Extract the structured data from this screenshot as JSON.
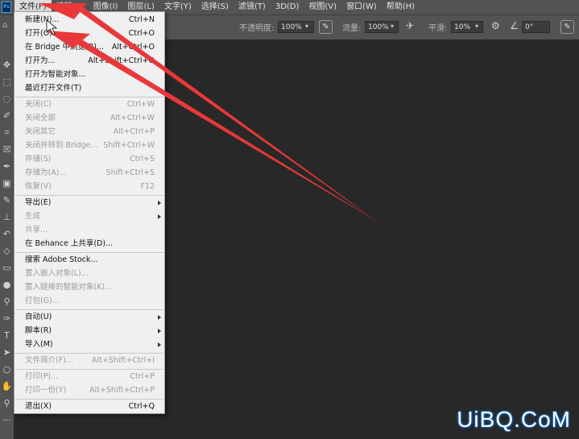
{
  "menubar": {
    "logo": "Ps",
    "items": [
      {
        "label": "文件(F)"
      },
      {
        "label": "编辑(E)"
      },
      {
        "label": "图像(I)"
      },
      {
        "label": "图层(L)"
      },
      {
        "label": "文字(Y)"
      },
      {
        "label": "选择(S)"
      },
      {
        "label": "滤镜(T)"
      },
      {
        "label": "3D(D)"
      },
      {
        "label": "视图(V)"
      },
      {
        "label": "窗口(W)"
      },
      {
        "label": "帮助(H)"
      }
    ]
  },
  "options": {
    "opacity_label": "不透明度:",
    "opacity_value": "100%",
    "flow_label": "流量:",
    "flow_value": "100%",
    "smoothing_label": "平滑:",
    "smoothing_value": "10%",
    "angle_value": "0°"
  },
  "file_menu": {
    "items": [
      {
        "label": "新建(N)...",
        "shortcut": "Ctrl+N"
      },
      {
        "label": "打开(O)...",
        "shortcut": "Ctrl+O"
      },
      {
        "label": "在 Bridge 中浏览(B)...",
        "shortcut": "Alt+Ctrl+O"
      },
      {
        "label": "打开为...",
        "shortcut": "Alt+Shift+Ctrl+O"
      },
      {
        "label": "打开为智能对象..."
      },
      {
        "label": "最近打开文件(T)"
      },
      {
        "label": "关闭(C)",
        "shortcut": "Ctrl+W"
      },
      {
        "label": "关闭全部",
        "shortcut": "Alt+Ctrl+W"
      },
      {
        "label": "关闭其它",
        "shortcut": "Alt+Ctrl+P"
      },
      {
        "label": "关闭并转到 Bridge...",
        "shortcut": "Shift+Ctrl+W"
      },
      {
        "label": "存储(S)",
        "shortcut": "Ctrl+S"
      },
      {
        "label": "存储为(A)...",
        "shortcut": "Shift+Ctrl+S"
      },
      {
        "label": "恢复(V)",
        "shortcut": "F12"
      },
      {
        "label": "导出(E)"
      },
      {
        "label": "生成"
      },
      {
        "label": "共享..."
      },
      {
        "label": "在 Behance 上共享(D)..."
      },
      {
        "label": "搜索 Adobe Stock..."
      },
      {
        "label": "置入嵌入对象(L)..."
      },
      {
        "label": "置入链接的智能对象(K)..."
      },
      {
        "label": "打包(G)..."
      },
      {
        "label": "自动(U)"
      },
      {
        "label": "脚本(R)"
      },
      {
        "label": "导入(M)"
      },
      {
        "label": "文件简介(F)...",
        "shortcut": "Alt+Shift+Ctrl+I"
      },
      {
        "label": "打印(P)...",
        "shortcut": "Ctrl+P"
      },
      {
        "label": "打印一份(Y)",
        "shortcut": "Alt+Shift+Ctrl+P"
      },
      {
        "label": "退出(X)",
        "shortcut": "Ctrl+Q"
      }
    ]
  },
  "watermark": "UiBQ.CoM",
  "colors": {
    "menubar_bg": "#535353",
    "workspace_bg": "#282828",
    "menu_bg": "#f0f0f0",
    "arrow": "#e8383a",
    "watermark_glow": "#0d6fd0"
  }
}
